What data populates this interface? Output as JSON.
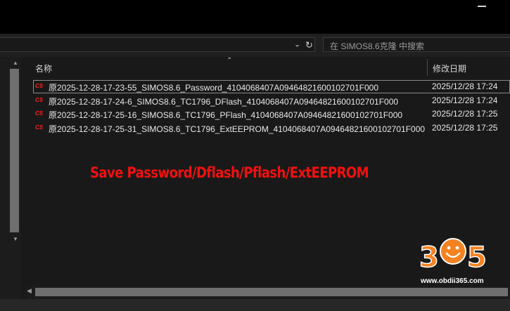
{
  "search": {
    "placeholder": "在 SIMOS8.6克隆 中搜索"
  },
  "columns": {
    "name": "名称",
    "date_modified": "修改日期"
  },
  "files": [
    {
      "name": "原2025-12-28-17-23-55_SIMOS8.6_Password_4104068407A09464821600102701F000",
      "date": "2025/12/28 17:24",
      "icon": "file-type-icon"
    },
    {
      "name": "原2025-12-28-17-24-6_SIMOS8.6_TC1796_DFlash_4104068407A09464821600102701F000",
      "date": "2025/12/28 17:24",
      "icon": "file-type-icon"
    },
    {
      "name": "原2025-12-28-17-25-16_SIMOS8.6_TC1796_PFlash_4104068407A09464821600102701F000",
      "date": "2025/12/28 17:25",
      "icon": "file-type-icon"
    },
    {
      "name": "原2025-12-28-17-25-31_SIMOS8.6_TC1796_ExtEEPROM_4104068407A09464821600102701F000",
      "date": "2025/12/28 17:25",
      "icon": "file-type-icon"
    }
  ],
  "caption": "Save Password/Dflash/Pflash/ExtEEPROM",
  "watermark": {
    "logo_text": "365",
    "url": "www.obdii365.com"
  },
  "colors": {
    "caption": "#f01010",
    "logo_orange": "#f58220",
    "background": "#191919"
  }
}
